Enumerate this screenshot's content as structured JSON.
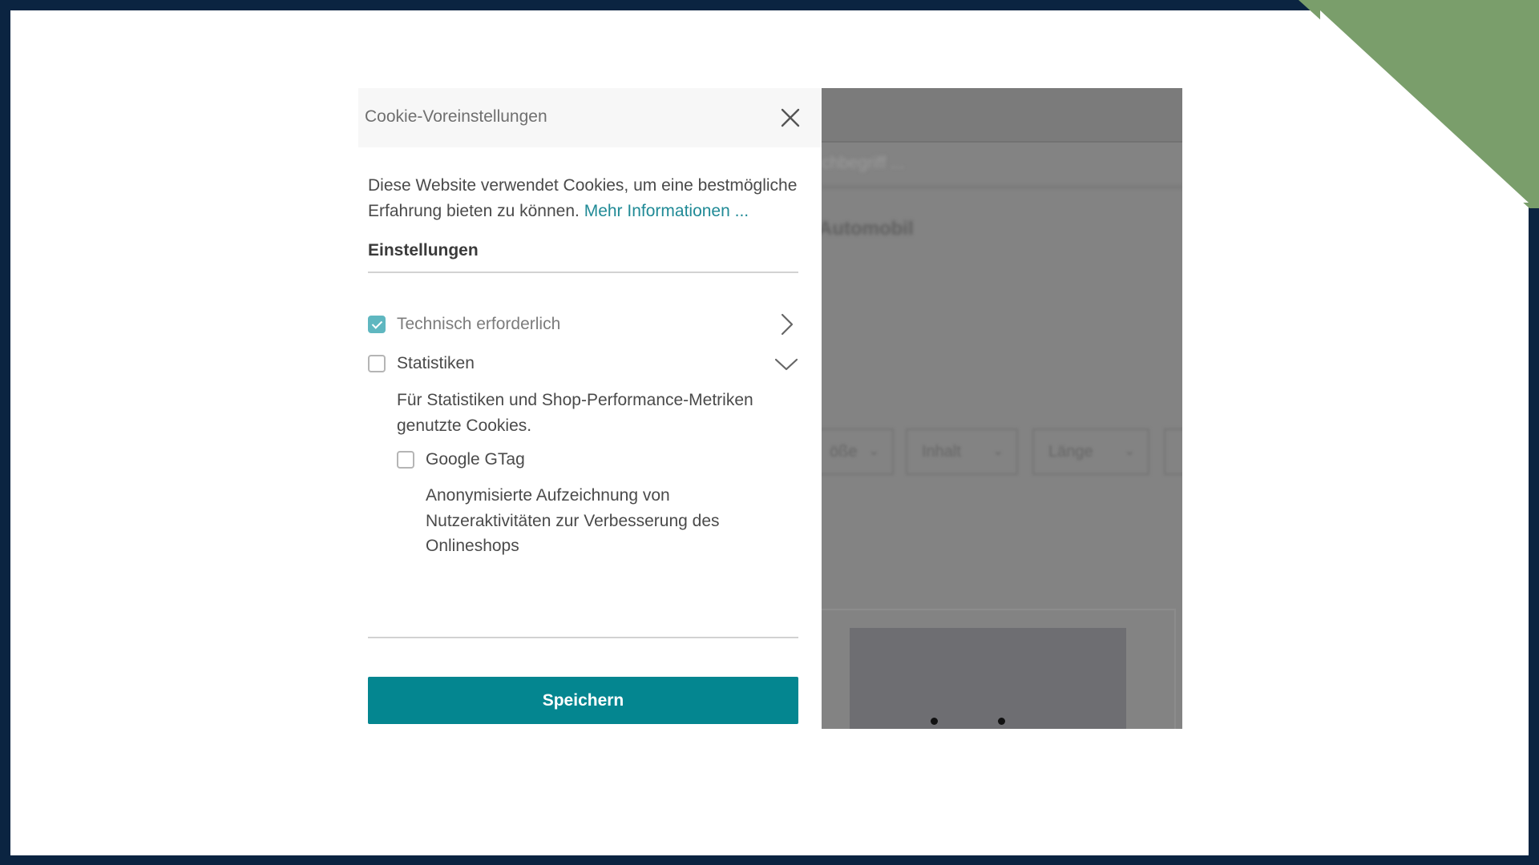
{
  "dialog": {
    "title": "Cookie-Voreinstellungen",
    "close_icon": "close-icon",
    "intro_text": "Diese Website verwendet Cookies, um eine bestmögliche Erfahrung bieten zu können. ",
    "more_info_link": "Mehr Informationen ...",
    "settings_heading": "Einstellungen",
    "options": [
      {
        "label": "Technisch erforderlich",
        "checked": true,
        "chevron": "chevron-right-icon"
      },
      {
        "label": "Statistiken",
        "checked": false,
        "chevron": "chevron-down-icon",
        "description": "Für Statistiken und Shop-Performance-Metriken genutzte Cookies.",
        "sub_options": [
          {
            "label": "Google GTag",
            "checked": false,
            "description": "Anonymisierte Aufzeichnung von Nutzeraktivitäten zur Verbesserung des Onlineshops"
          }
        ]
      }
    ],
    "save_button": "Speichern"
  },
  "background_page": {
    "search_placeholder": "chbegriff ...",
    "category": "Automobil",
    "filters": [
      "öße",
      "Inhalt",
      "Länge"
    ]
  },
  "colors": {
    "accent": "#048690",
    "link": "#208a96",
    "checkbox_checked": "#5fb7c0",
    "frame": "#0b2441",
    "corner_band": "#7a9e6b"
  }
}
